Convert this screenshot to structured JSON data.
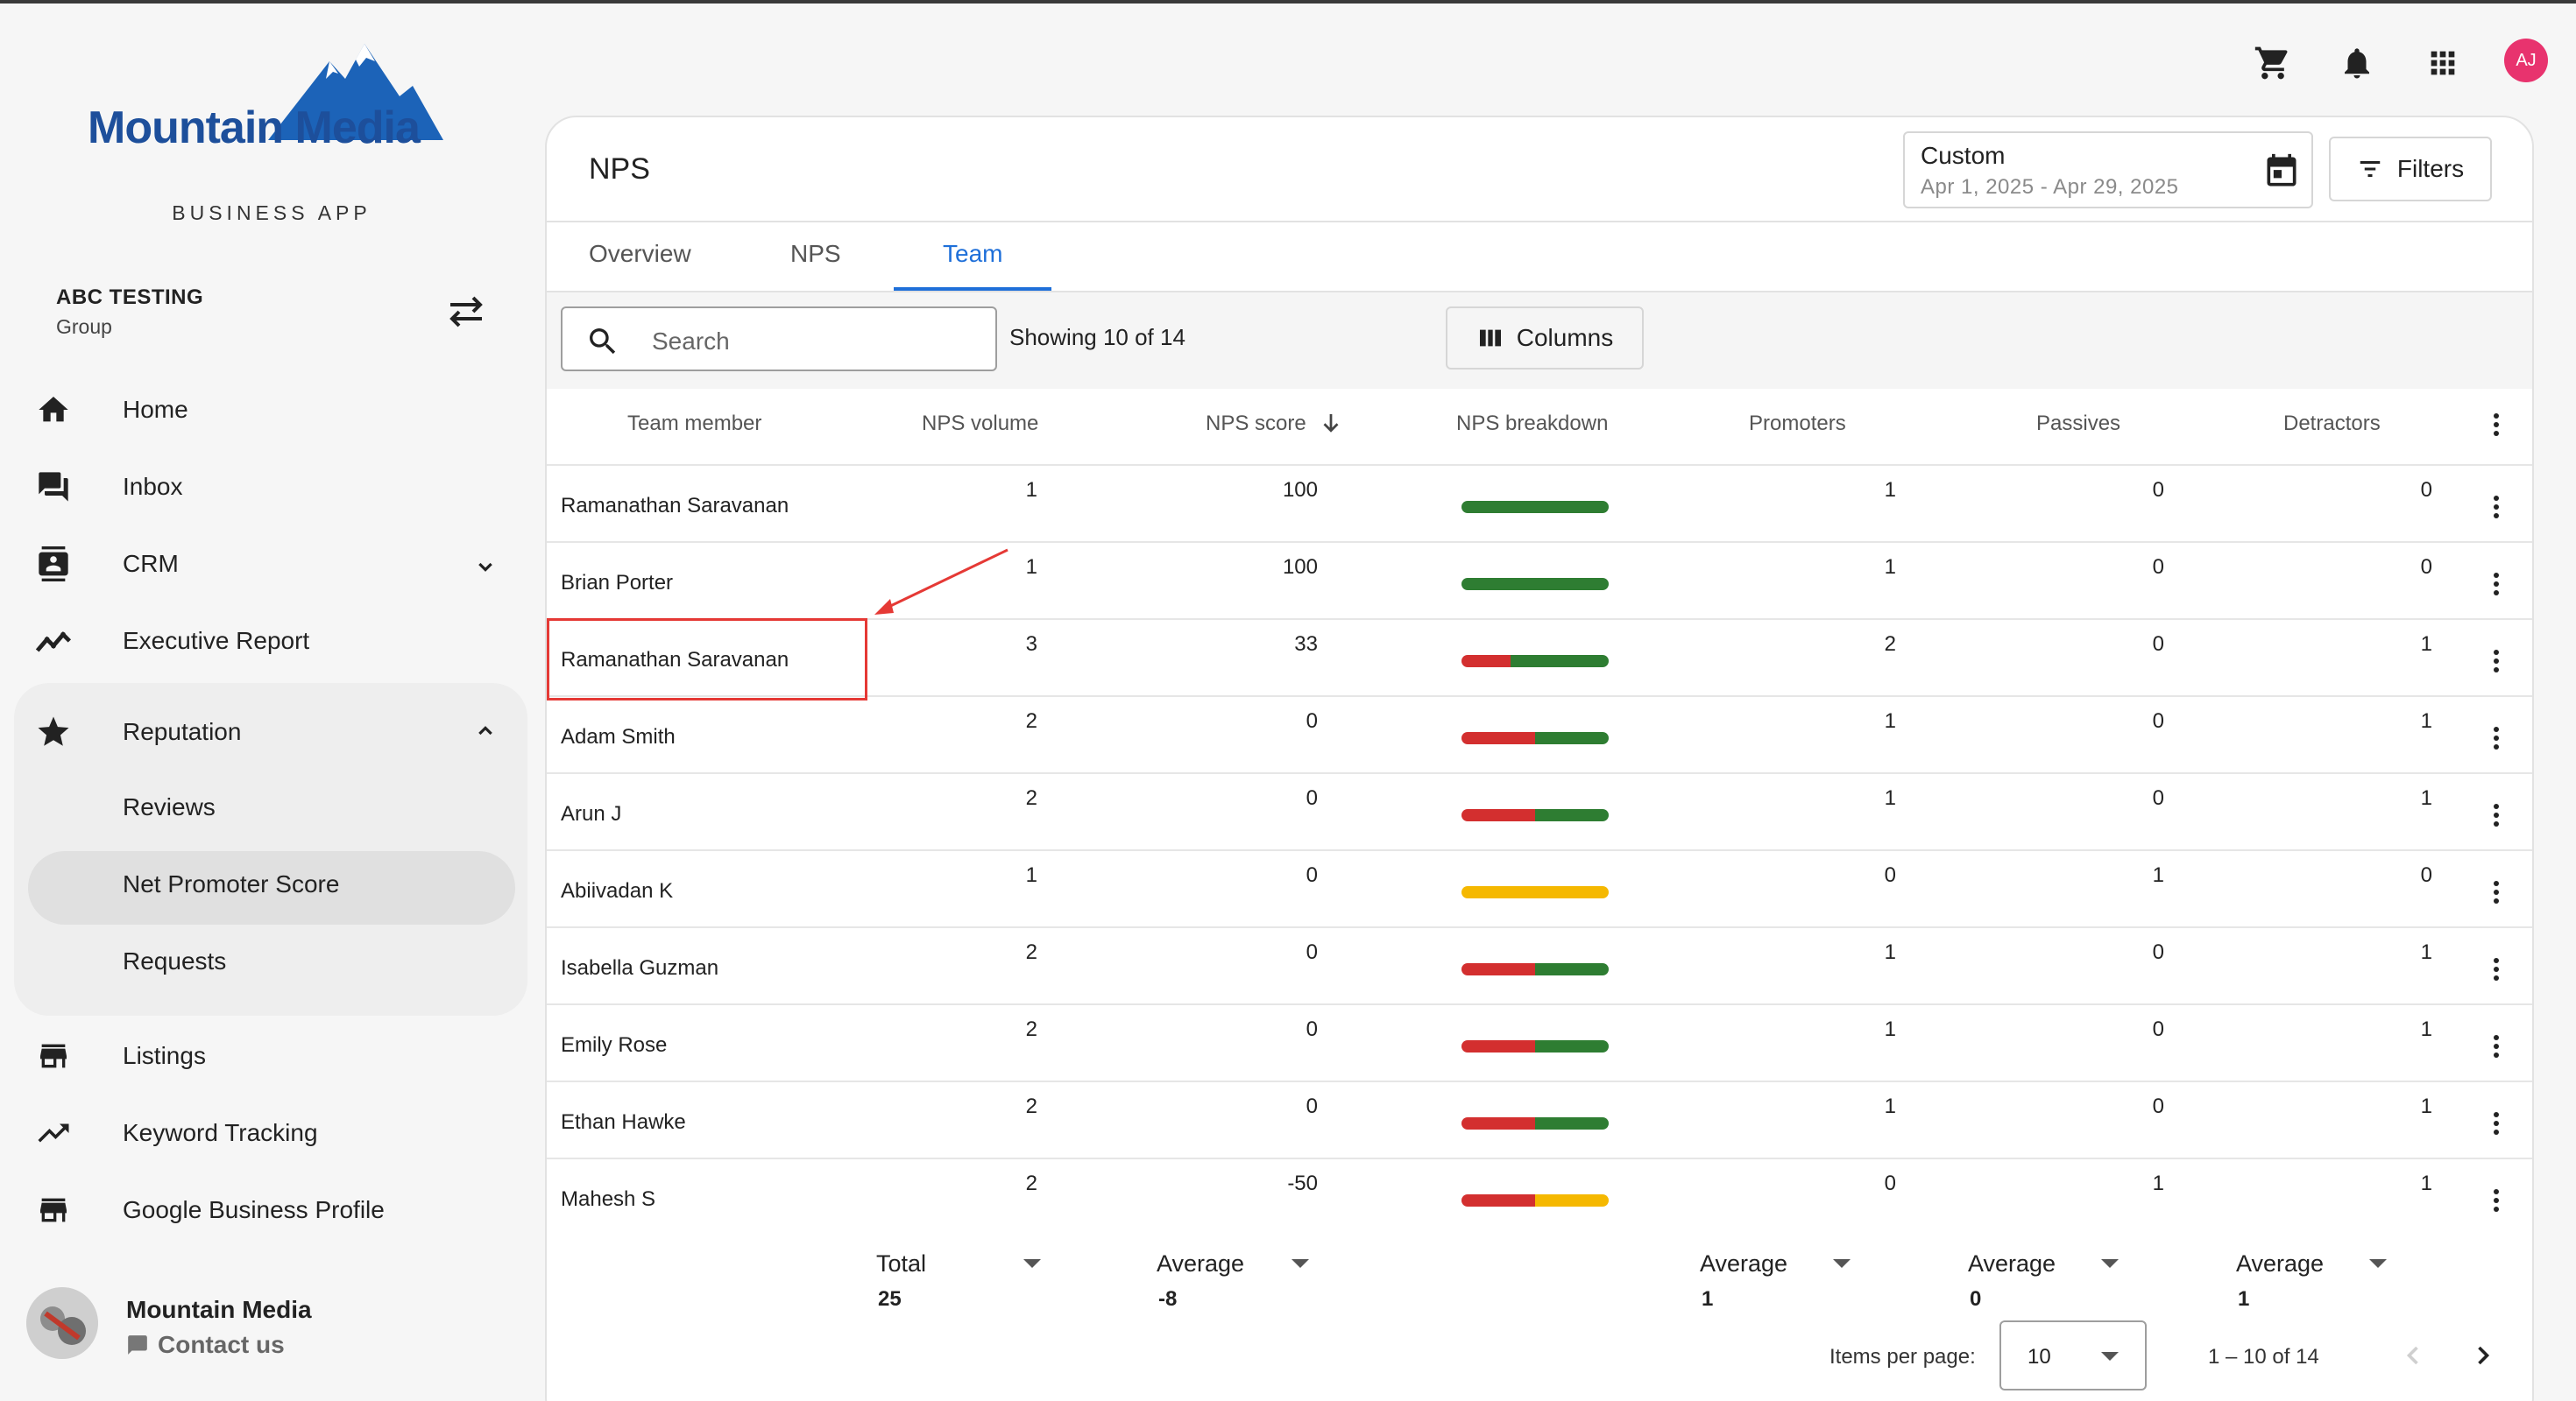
{
  "app": {
    "brand": "Mountain Media",
    "subtitle": "BUSINESS APP"
  },
  "account": {
    "name": "ABC TESTING",
    "type": "Group"
  },
  "sidebar": {
    "items": [
      {
        "label": "Home",
        "icon": "home-icon"
      },
      {
        "label": "Inbox",
        "icon": "inbox-icon"
      },
      {
        "label": "CRM",
        "icon": "contacts-icon"
      },
      {
        "label": "Executive Report",
        "icon": "trend-icon"
      },
      {
        "label": "Reputation",
        "icon": "star-icon"
      },
      {
        "label": "Listings",
        "icon": "store-icon"
      },
      {
        "label": "Keyword Tracking",
        "icon": "trend-icon"
      },
      {
        "label": "Google Business Profile",
        "icon": "store-icon"
      }
    ],
    "reputation_sub": [
      "Reviews",
      "Net Promoter Score",
      "Requests"
    ],
    "active_sub": "Net Promoter Score"
  },
  "footer": {
    "org": "Mountain Media",
    "contact": "Contact us"
  },
  "topbar": {
    "avatar_initials": "AJ",
    "avatar_color": "#e8336e"
  },
  "page": {
    "title": "NPS",
    "date": {
      "label": "Custom",
      "range": "Apr 1, 2025 - Apr 29, 2025"
    },
    "filters_label": "Filters",
    "tabs": [
      "Overview",
      "NPS",
      "Team"
    ],
    "active_tab": "Team",
    "search_placeholder": "Search",
    "showing": "Showing 10 of 14",
    "columns_label": "Columns"
  },
  "table": {
    "headers": [
      "Team member",
      "NPS volume",
      "NPS score",
      "NPS breakdown",
      "Promoters",
      "Passives",
      "Detractors"
    ],
    "sorted_column": "NPS score",
    "sort_direction": "descending",
    "rows": [
      {
        "member": "Ramanathan Saravanan",
        "volume": "1",
        "score": "100",
        "promoters": "1",
        "passives": "0",
        "detractors": "0"
      },
      {
        "member": "Brian Porter",
        "volume": "1",
        "score": "100",
        "promoters": "1",
        "passives": "0",
        "detractors": "0"
      },
      {
        "member": "Ramanathan Saravanan",
        "volume": "3",
        "score": "33",
        "promoters": "2",
        "passives": "0",
        "detractors": "1"
      },
      {
        "member": "Adam Smith",
        "volume": "2",
        "score": "0",
        "promoters": "1",
        "passives": "0",
        "detractors": "1"
      },
      {
        "member": "Arun J",
        "volume": "2",
        "score": "0",
        "promoters": "1",
        "passives": "0",
        "detractors": "1"
      },
      {
        "member": "Abiivadan K",
        "volume": "1",
        "score": "0",
        "promoters": "0",
        "passives": "1",
        "detractors": "0"
      },
      {
        "member": "Isabella Guzman",
        "volume": "2",
        "score": "0",
        "promoters": "1",
        "passives": "0",
        "detractors": "1"
      },
      {
        "member": "Emily Rose",
        "volume": "2",
        "score": "0",
        "promoters": "1",
        "passives": "0",
        "detractors": "1"
      },
      {
        "member": "Ethan Hawke",
        "volume": "2",
        "score": "0",
        "promoters": "1",
        "passives": "0",
        "detractors": "1"
      },
      {
        "member": "Mahesh S",
        "volume": "2",
        "score": "-50",
        "promoters": "0",
        "passives": "1",
        "detractors": "1"
      }
    ],
    "highlighted_row": 3,
    "breakdown_colors": {
      "detractor": "#d32f2f",
      "passive": "#f5b800",
      "promoter": "#2e7d32"
    },
    "summary": {
      "volume": {
        "label": "Total",
        "value": "25"
      },
      "score": {
        "label": "Average",
        "value": "-8"
      },
      "promoters": {
        "label": "Average",
        "value": "1"
      },
      "passives": {
        "label": "Average",
        "value": "0"
      },
      "detractors": {
        "label": "Average",
        "value": "1"
      }
    }
  },
  "pagination": {
    "items_per_page_label": "Items per page:",
    "items_per_page": "10",
    "range": "1 – 10 of 14"
  }
}
